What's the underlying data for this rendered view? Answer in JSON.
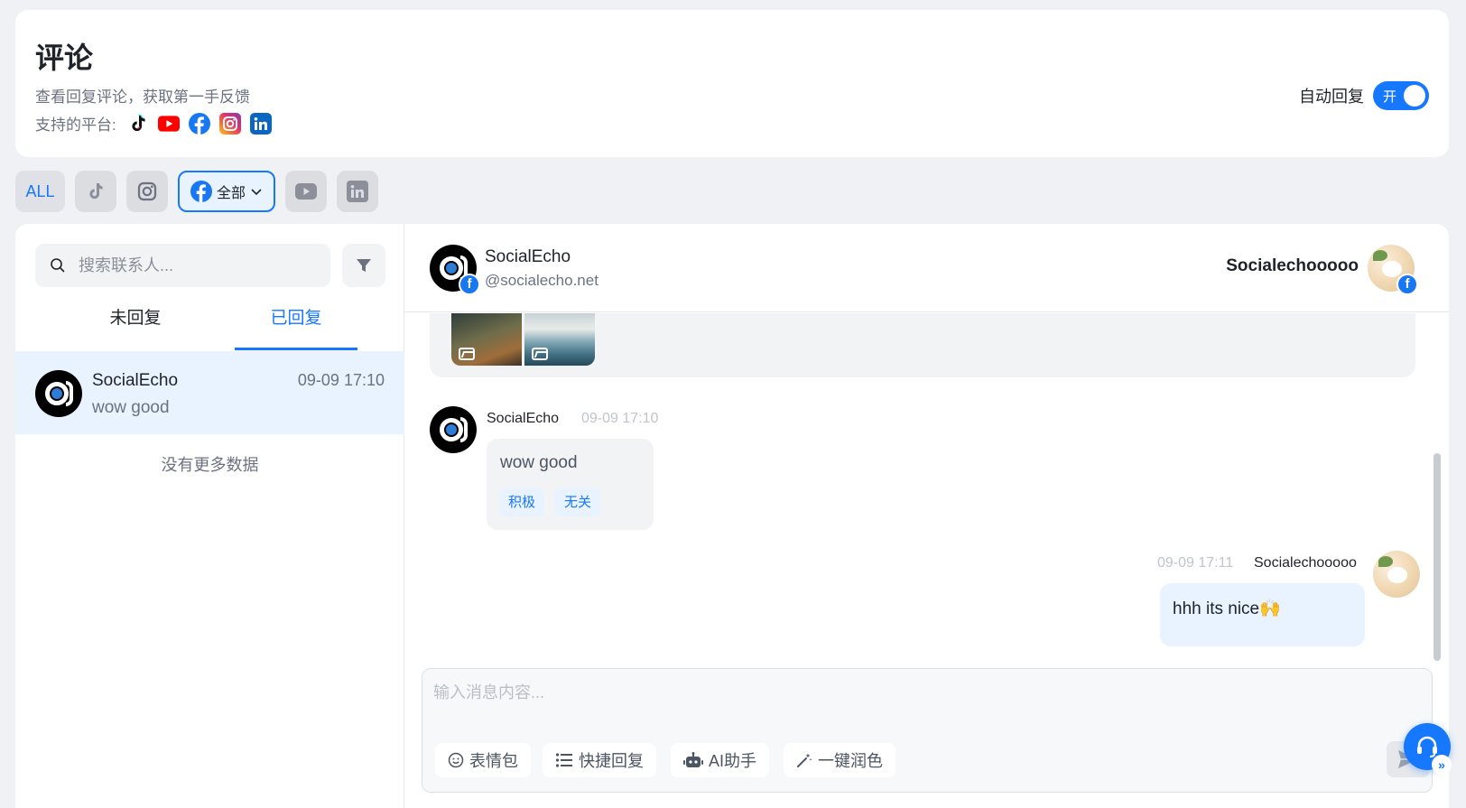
{
  "header": {
    "title": "评论",
    "subtitle": "查看回复评论，获取第一手反馈",
    "platforms_label": "支持的平台:",
    "platforms": [
      "tiktok",
      "youtube",
      "facebook",
      "instagram",
      "linkedin"
    ],
    "auto_reply_label": "自动回复",
    "auto_reply_state": "开"
  },
  "filters": {
    "all_label": "ALL",
    "selected_label": "全部",
    "items": [
      "ALL",
      "tiktok",
      "instagram",
      "facebook",
      "youtube",
      "linkedin"
    ]
  },
  "sidebar": {
    "search_placeholder": "搜索联系人...",
    "tabs": [
      {
        "label": "未回复"
      },
      {
        "label": "已回复"
      }
    ],
    "conversations": [
      {
        "name": "SocialEcho",
        "time": "09-09 17:10",
        "preview": "wow good"
      }
    ],
    "no_more": "没有更多数据"
  },
  "chat": {
    "contact_name": "SocialEcho",
    "contact_handle": "@socialecho.net",
    "account_name": "Socialechooooo",
    "messages": [
      {
        "direction": "in",
        "author": "SocialEcho",
        "time": "09-09 17:10",
        "text": "wow good",
        "tags": [
          "积极",
          "无关"
        ]
      },
      {
        "direction": "out",
        "author": "Socialechooooo",
        "time": "09-09 17:11",
        "text": "hhh its nice🙌"
      }
    ]
  },
  "composer": {
    "placeholder": "输入消息内容...",
    "tools": [
      {
        "label": "表情包",
        "icon": "smile-icon"
      },
      {
        "label": "快捷回复",
        "icon": "list-icon"
      },
      {
        "label": "AI助手",
        "icon": "robot-icon"
      },
      {
        "label": "一键润色",
        "icon": "magic-wand-icon"
      }
    ]
  },
  "colors": {
    "accent": "#1677ff",
    "facebook": "#1877f2",
    "youtube": "#ff0000",
    "linkedin": "#0a66c2"
  }
}
